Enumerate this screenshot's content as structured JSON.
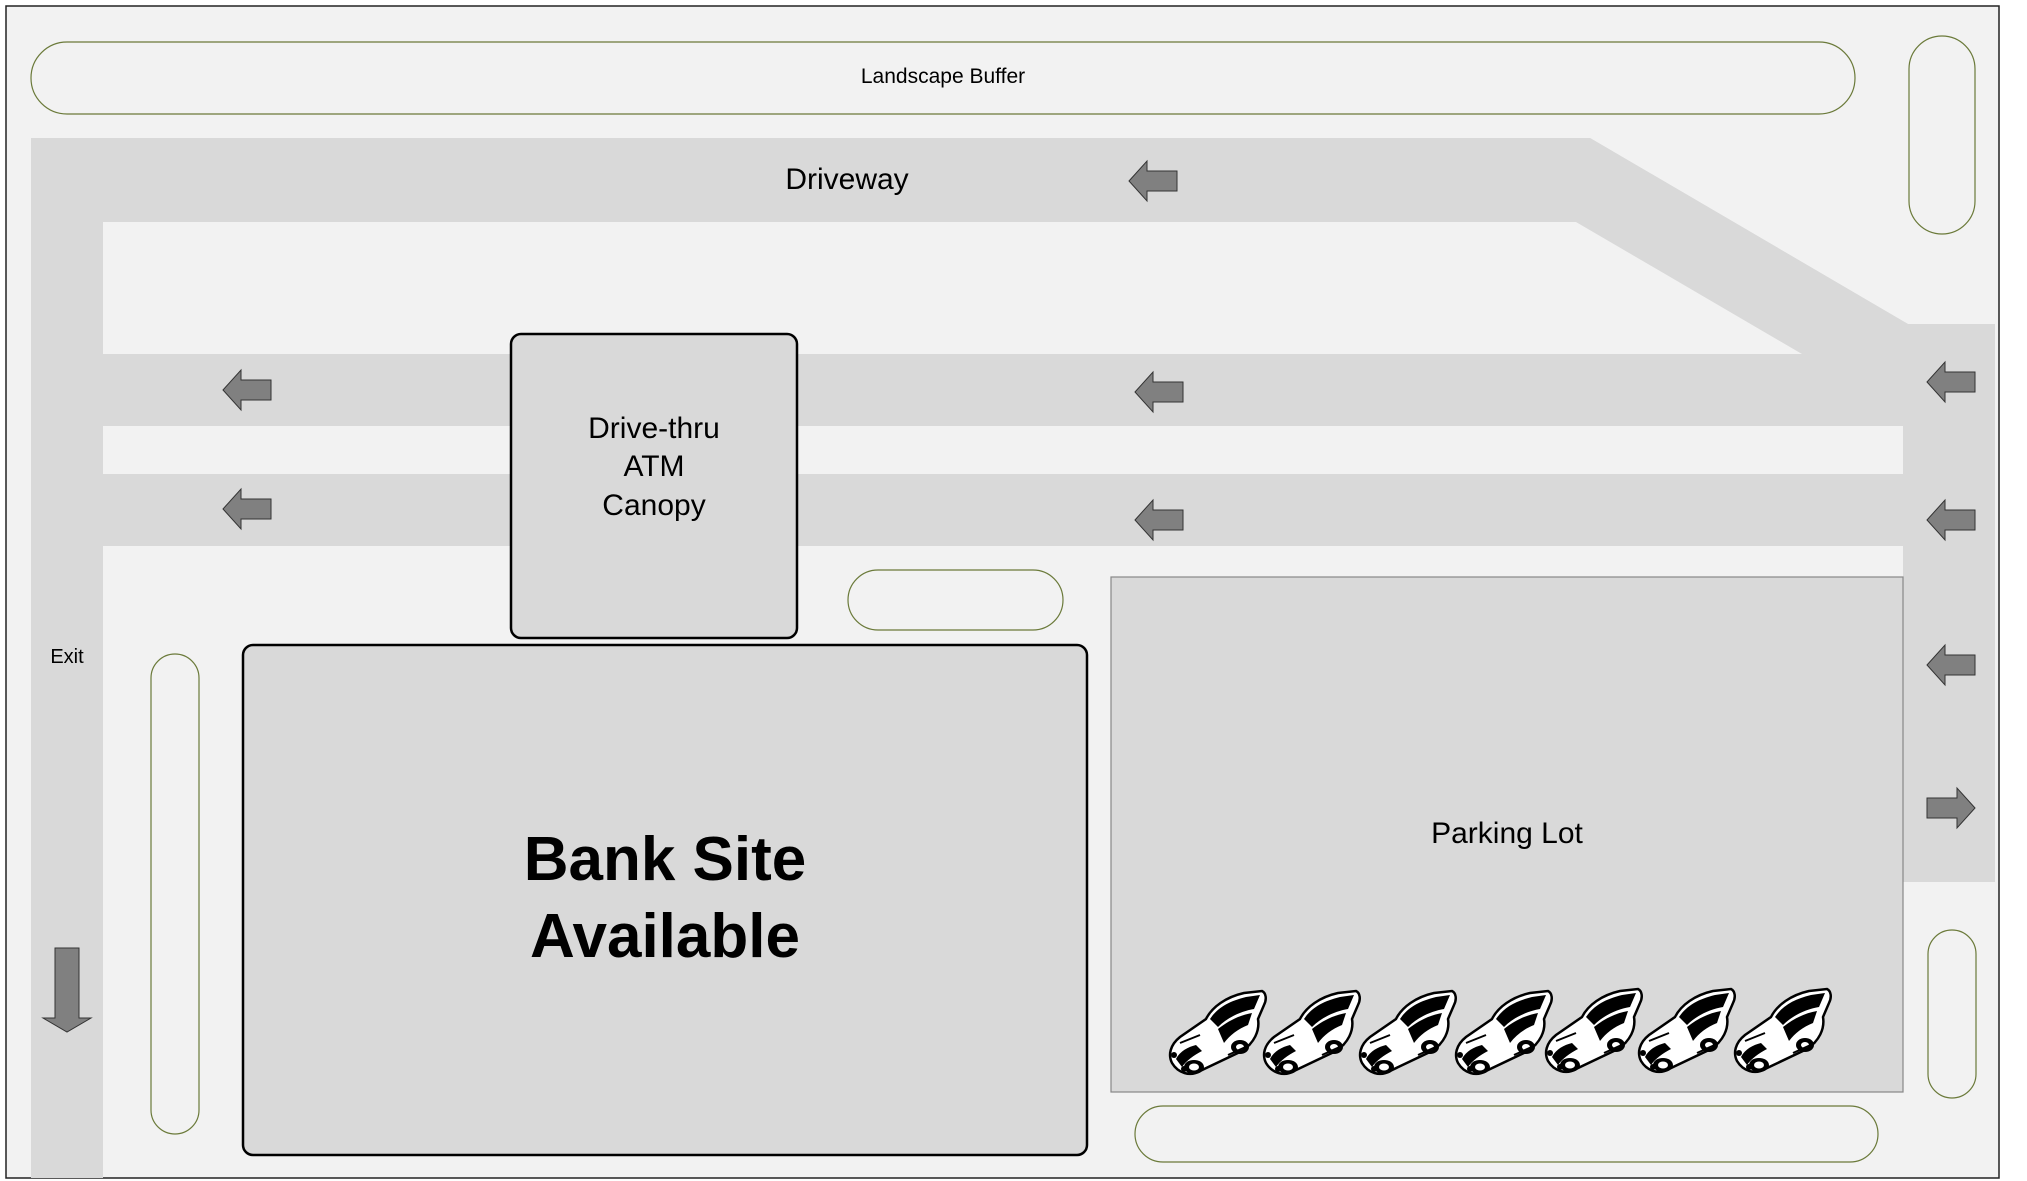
{
  "labels": {
    "landscape_buffer": "Landscape Buffer",
    "driveway": "Driveway",
    "exit": "Exit",
    "atm_line1": "Drive-thru",
    "atm_line2": "ATM",
    "atm_line3": "Canopy",
    "bank_line1": "Bank Site",
    "bank_line2": "Available",
    "parking_lot": "Parking Lot"
  },
  "colors": {
    "ground": "#f2f2f2",
    "pavement": "#d9d9d9",
    "arrow_fill": "#808080",
    "buffer_stroke": "#6b7a3a",
    "outline": "#000000"
  },
  "icons": {
    "arrows": [
      "arrow-left-icon",
      "arrow-down-icon",
      "arrow-right-icon"
    ],
    "car": "car-icon",
    "car_count": 7
  }
}
